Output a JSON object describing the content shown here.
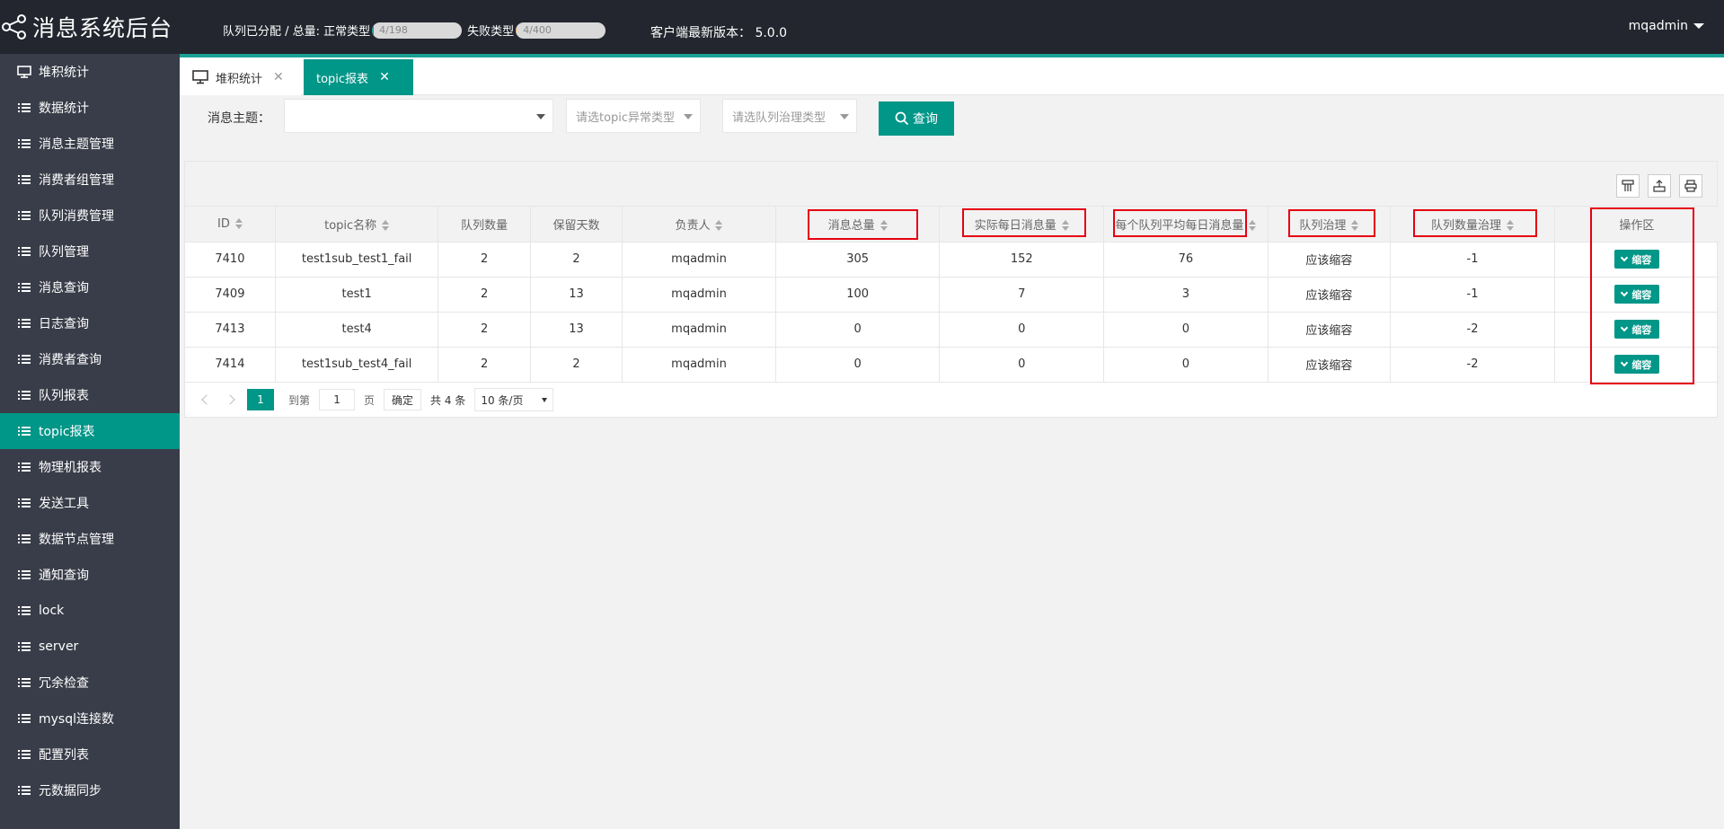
{
  "header": {
    "app_title": "消息系统后台",
    "stats_label": "队列已分配 / 总量: 正常类型",
    "normal_progress_text": "4/198",
    "normal_progress": 0.02,
    "failed_label": "失败类型",
    "failed_progress_text": "4/400",
    "failed_progress": 0.01,
    "version_text": "客户端最新版本： 5.0.0",
    "user": "mqadmin"
  },
  "sidebar": {
    "items": [
      {
        "label": "堆积统计",
        "icon": "monitor-icon"
      },
      {
        "label": "数据统计",
        "icon": "list-icon"
      },
      {
        "label": "消息主题管理",
        "icon": "list-icon"
      },
      {
        "label": "消费者组管理",
        "icon": "list-icon"
      },
      {
        "label": "队列消费管理",
        "icon": "list-icon"
      },
      {
        "label": "队列管理",
        "icon": "list-icon"
      },
      {
        "label": "消息查询",
        "icon": "list-icon"
      },
      {
        "label": "日志查询",
        "icon": "list-icon"
      },
      {
        "label": "消费者查询",
        "icon": "list-icon"
      },
      {
        "label": "队列报表",
        "icon": "list-icon"
      },
      {
        "label": "topic报表",
        "icon": "list-icon",
        "active": true
      },
      {
        "label": "物理机报表",
        "icon": "list-icon"
      },
      {
        "label": "发送工具",
        "icon": "list-icon"
      },
      {
        "label": "数据节点管理",
        "icon": "list-icon"
      },
      {
        "label": "通知查询",
        "icon": "list-icon"
      },
      {
        "label": "lock",
        "icon": "list-icon"
      },
      {
        "label": "server",
        "icon": "list-icon"
      },
      {
        "label": "冗余检查",
        "icon": "list-icon"
      },
      {
        "label": "mysql连接数",
        "icon": "list-icon"
      },
      {
        "label": "配置列表",
        "icon": "list-icon"
      },
      {
        "label": "元数据同步",
        "icon": "list-icon"
      }
    ]
  },
  "tabs": [
    {
      "label": "堆积统计",
      "close": "✕"
    },
    {
      "label": "topic报表",
      "close": "✕"
    }
  ],
  "filters": {
    "topic_label": "消息主题：",
    "topic_value": "",
    "abnormal_placeholder": "请选topic异常类型",
    "governance_placeholder": "请选队列治理类型",
    "query_button": "查询"
  },
  "table": {
    "columns": [
      "ID",
      "topic名称",
      "队列数量",
      "保留天数",
      "负责人",
      "消息总量",
      "实际每日消息量",
      "每个队列平均每日消息量",
      "队列治理",
      "队列数量治理",
      "操作区"
    ],
    "rows": [
      [
        "7410",
        "test1sub_test1_fail",
        "2",
        "2",
        "mqadmin",
        "305",
        "152",
        "76",
        "应该缩容",
        "-1",
        "缩容"
      ],
      [
        "7409",
        "test1",
        "2",
        "13",
        "mqadmin",
        "100",
        "7",
        "3",
        "应该缩容",
        "-1",
        "缩容"
      ],
      [
        "7413",
        "test4",
        "2",
        "13",
        "mqadmin",
        "0",
        "0",
        "0",
        "应该缩容",
        "-2",
        "缩容"
      ],
      [
        "7414",
        "test1sub_test4_fail",
        "2",
        "2",
        "mqadmin",
        "0",
        "0",
        "0",
        "应该缩容",
        "-2",
        "缩容"
      ]
    ]
  },
  "pager": {
    "current_page": "1",
    "goto_label": "到第",
    "goto_value": "1",
    "page_label": "页",
    "ok_button": "确定",
    "total": "共 4 条",
    "page_size": "10 条/页"
  },
  "colors": {
    "accent": "#009688",
    "sidebar_bg": "#393d49",
    "topbar_bg": "#23262e",
    "highlight": "#e60012"
  }
}
